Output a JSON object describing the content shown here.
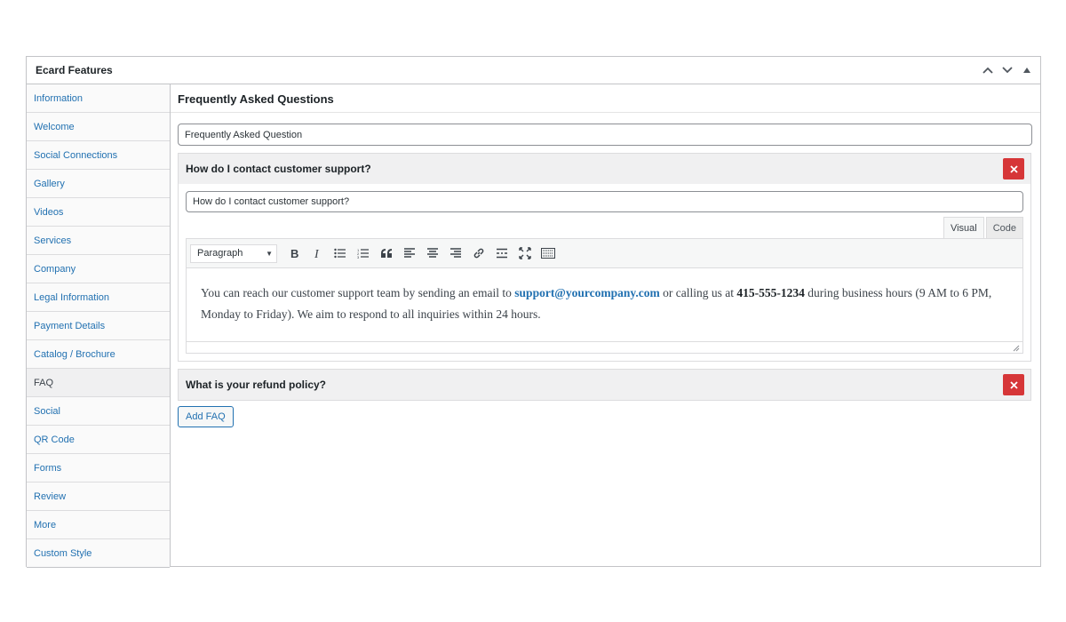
{
  "panel": {
    "title": "Ecard Features"
  },
  "sidebar": {
    "items": [
      {
        "label": "Information"
      },
      {
        "label": "Welcome"
      },
      {
        "label": "Social Connections"
      },
      {
        "label": "Gallery"
      },
      {
        "label": "Videos"
      },
      {
        "label": "Services"
      },
      {
        "label": "Company"
      },
      {
        "label": "Legal Information"
      },
      {
        "label": "Payment Details"
      },
      {
        "label": "Catalog / Brochure"
      },
      {
        "label": "FAQ"
      },
      {
        "label": "Social"
      },
      {
        "label": "QR Code"
      },
      {
        "label": "Forms"
      },
      {
        "label": "Review"
      },
      {
        "label": "More"
      },
      {
        "label": "Custom Style"
      }
    ],
    "active_index": 10
  },
  "main": {
    "section_title": "Frequently Asked Questions",
    "heading_field_value": "Frequently Asked Question",
    "faqs": [
      {
        "title": "How do I contact customer support?",
        "question_value": "How do I contact customer support?",
        "editor": {
          "tab_visual": "Visual",
          "tab_code": "Code",
          "format": "Paragraph",
          "text_before_email": "You can reach our customer support team by sending an email to ",
          "email": "support@yourcompany.com",
          "text_before_phone": " or calling us at ",
          "phone": "415-555-1234",
          "text_after_phone": " during business hours (9 AM to 6 PM, Monday to Friday). We aim to respond to all inquiries within 24 hours."
        }
      },
      {
        "title": "What is your refund policy?"
      }
    ],
    "add_button": "Add FAQ"
  },
  "colors": {
    "link": "#2271b1",
    "delete": "#d63638",
    "border": "#c3c4c7"
  }
}
